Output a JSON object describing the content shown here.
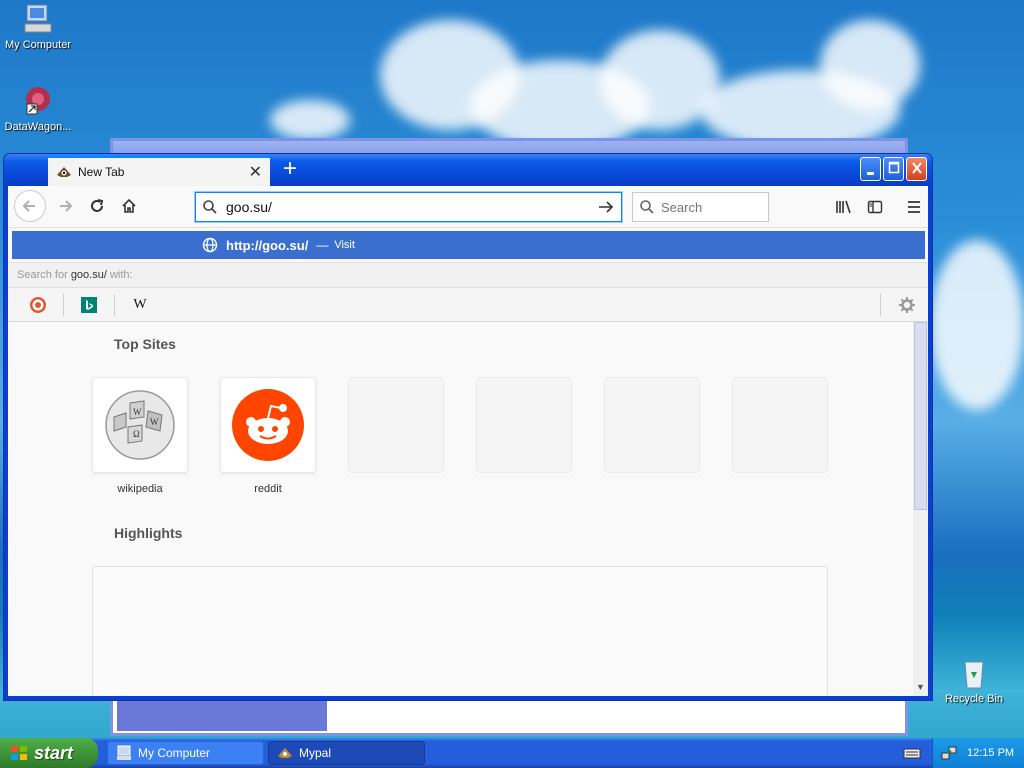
{
  "desktop": {
    "icons": [
      {
        "label": "My Computer"
      },
      {
        "label": "DataWagon..."
      },
      {
        "label": "Recycle Bin"
      }
    ]
  },
  "browser": {
    "tab": {
      "title": "New Tab"
    },
    "url_value": "goo.su/",
    "search_placeholder": "Search",
    "suggestion": {
      "url": "http://goo.su/",
      "dash": "—",
      "action": "Visit"
    },
    "search_for": {
      "prefix": "Search for",
      "query": "goo.su/",
      "suffix": "with:"
    },
    "engines": [
      "DuckDuckGo",
      "Bing",
      "Wikipedia"
    ],
    "engines_w": "W",
    "top_sites_title": "Top Sites",
    "top_sites": [
      {
        "label": "wikipedia"
      },
      {
        "label": "reddit"
      }
    ],
    "highlights_title": "Highlights"
  },
  "taskbar": {
    "start_label": "start",
    "tasks": [
      {
        "label": "My Computer"
      },
      {
        "label": "Mypal"
      }
    ],
    "clock": "12:15 PM"
  },
  "colors": {
    "accent": "#0a84ff",
    "suggestion_bg": "#3b6fcf",
    "reddit": "#ff4500",
    "xp_blue": "#245edb",
    "start_green": "#3c8f37"
  }
}
